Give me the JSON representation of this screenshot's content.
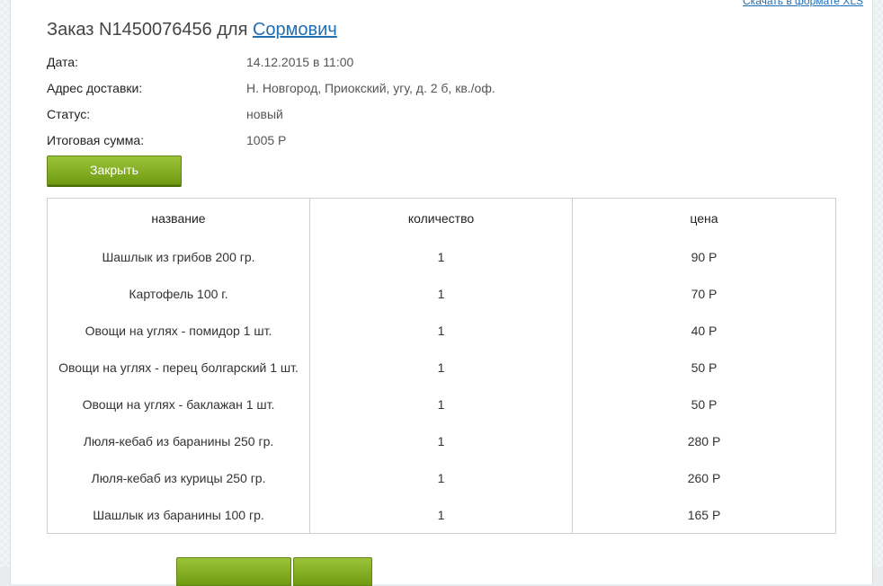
{
  "header": {
    "xls_link": "Скачать в формате XLS",
    "title_prefix": "Заказ N1450076456 для",
    "customer_name": "Сормович"
  },
  "info": [
    {
      "label": "Дата:",
      "value": "14.12.2015 в 11:00"
    },
    {
      "label": "Адрес доставки:",
      "value": "Н. Новгород, Приокский, угу, д. 2 б, кв./оф."
    },
    {
      "label": "Статус:",
      "value": "новый"
    },
    {
      "label": "Итоговая сумма:",
      "value": "1005 Р"
    }
  ],
  "close_button": "Закрыть",
  "table": {
    "columns": [
      "название",
      "количество",
      "цена"
    ],
    "rows": [
      [
        "Шашлык из грибов 200 гр.",
        "1",
        "90 Р"
      ],
      [
        "Картофель 100 г.",
        "1",
        "70 Р"
      ],
      [
        "Овощи на углях - помидор 1 шт.",
        "1",
        "40 Р"
      ],
      [
        "Овощи на углях - перец болгарский 1 шт.",
        "1",
        "50 Р"
      ],
      [
        "Овощи на углях - баклажан 1 шт.",
        "1",
        "50 Р"
      ],
      [
        "Люля-кебаб из баранины 250 гр.",
        "1",
        "280 Р"
      ],
      [
        "Люля-кебаб из курицы 250 гр.",
        "1",
        "260 Р"
      ],
      [
        "Шашлык из баранины 100 гр.",
        "1",
        "165 Р"
      ]
    ]
  },
  "colors": {
    "accent_green": "#7fab1e",
    "link_blue": "#1f6fb5"
  }
}
